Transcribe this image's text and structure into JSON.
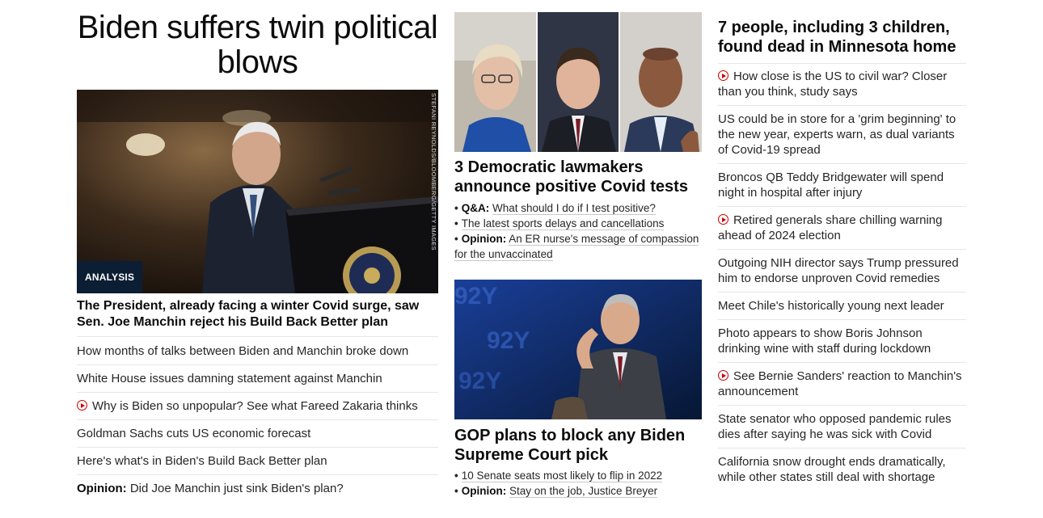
{
  "column1": {
    "title": "Biden suffers twin political blows",
    "image_credit": "STEFANI REYNOLDS/BLOOMBERG/GETTY IMAGES",
    "badge": "ANALYSIS",
    "headline": "The President, already facing a winter Covid surge, saw Sen. Joe Manchin reject his Build Back Better plan",
    "items": [
      {
        "text": "How months of talks between Biden and Manchin broke down",
        "video": false,
        "prefix": ""
      },
      {
        "text": "White House issues damning statement against Manchin",
        "video": false,
        "prefix": ""
      },
      {
        "text": "Why is Biden so unpopular? See what Fareed Zakaria thinks",
        "video": true,
        "prefix": ""
      },
      {
        "text": "Goldman Sachs cuts US economic forecast",
        "video": false,
        "prefix": ""
      },
      {
        "text": "Here's what's in Biden's Build Back Better plan",
        "video": false,
        "prefix": ""
      },
      {
        "text": "Did Joe Manchin just sink Biden's plan?",
        "video": false,
        "prefix": "Opinion:"
      }
    ]
  },
  "column2": {
    "story1": {
      "headline": "3 Democratic lawmakers announce positive Covid tests",
      "links": [
        {
          "prefix": "Q&A:",
          "text": "What should I do if I test positive?"
        },
        {
          "prefix": "",
          "text": "The latest sports delays and cancellations"
        },
        {
          "prefix": "Opinion:",
          "text": "An ER nurse's message of compassion for the unvaccinated"
        }
      ]
    },
    "story2": {
      "headline": "GOP plans to block any Biden Supreme Court pick",
      "backdrop_text": "92Y",
      "links": [
        {
          "prefix": "",
          "text": "10 Senate seats most likely to flip in 2022"
        },
        {
          "prefix": "Opinion:",
          "text": "Stay on the job, Justice Breyer"
        }
      ]
    }
  },
  "column3": {
    "headline": "7 people, including 3 children, found dead in Minnesota home",
    "items": [
      {
        "text": "How close is the US to civil war? Closer than you think, study says",
        "video": true
      },
      {
        "text": "US could be in store for a 'grim beginning' to the new year, experts warn, as dual variants of Covid-19 spread",
        "video": false
      },
      {
        "text": "Broncos QB Teddy Bridgewater will spend night in hospital after injury",
        "video": false
      },
      {
        "text": "Retired generals share chilling warning ahead of 2024 election",
        "video": true
      },
      {
        "text": "Outgoing NIH director says Trump pressured him to endorse unproven Covid remedies",
        "video": false
      },
      {
        "text": "Meet Chile's historically young next leader",
        "video": false
      },
      {
        "text": "Photo appears to show Boris Johnson drinking wine with staff during lockdown",
        "video": false
      },
      {
        "text": "See Bernie Sanders' reaction to Manchin's announcement",
        "video": true
      },
      {
        "text": "State senator who opposed pandemic rules dies after saying he was sick with Covid",
        "video": false
      },
      {
        "text": "California snow drought ends dramatically, while other states still deal with shortage",
        "video": false
      }
    ]
  },
  "colors": {
    "accent_red": "#cc0000",
    "badge_bg": "#0c1e33",
    "divider": "#e6e6e6"
  }
}
